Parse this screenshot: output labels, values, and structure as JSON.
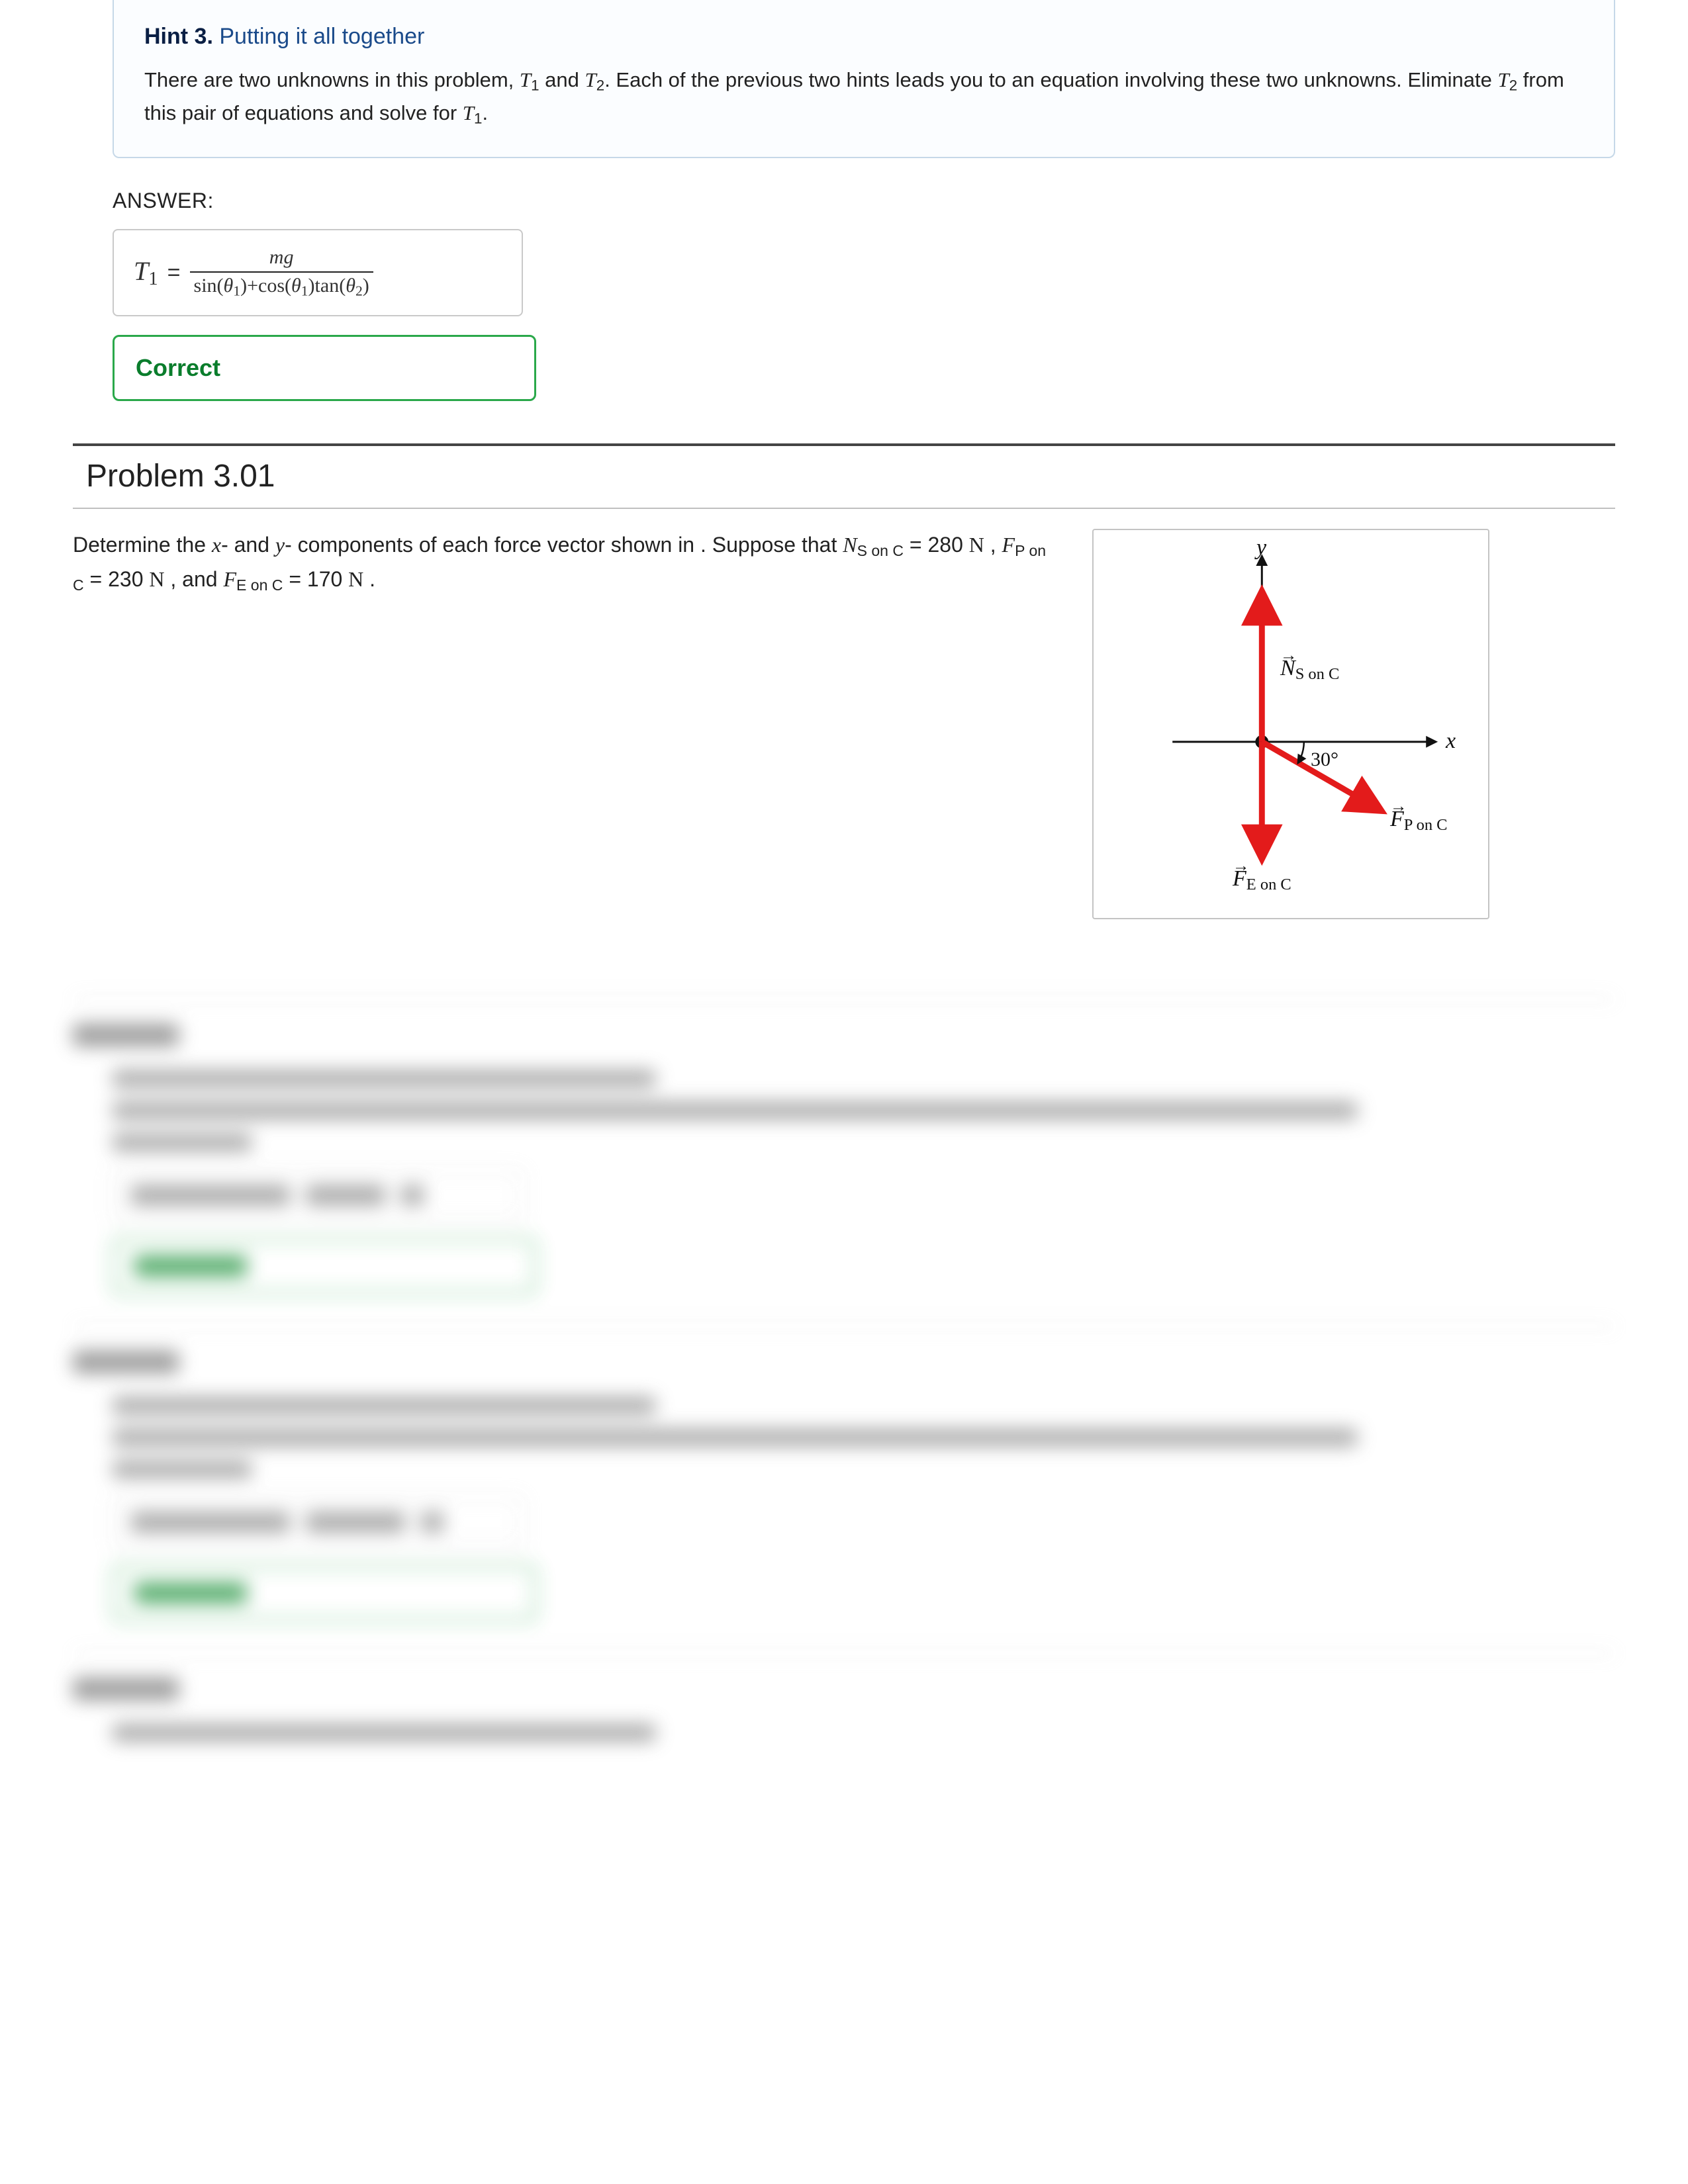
{
  "hint": {
    "number": "Hint 3.",
    "name": "Putting it all together",
    "body_1a": "There are two unknowns in this problem, ",
    "T1": "T",
    "T1sub": "1",
    "body_1b": " and ",
    "T2": "T",
    "T2sub": "2",
    "body_1c": ". Each of the previous two hints leads you to an equation involving these two unknowns. Eliminate ",
    "body_1d": " from this pair of equations and solve for ",
    "body_1e": "."
  },
  "answer_label": "ANSWER:",
  "formula": {
    "lhs": "T",
    "lhs_sub": "1",
    "eq": "=",
    "num_m": "m",
    "num_g": "g",
    "den_sin": "sin",
    "den_th1": "θ",
    "den_1": "1",
    "den_plus": "+",
    "den_cos": "cos",
    "den_tan": "tan",
    "den_th2": "θ",
    "den_2": "2",
    "lp": "(",
    "rp": ")"
  },
  "correct_label": "Correct",
  "problem": {
    "title": "Problem 3.01",
    "p1": "Determine the ",
    "xvar": "x",
    "p2": "- and ",
    "yvar": "y",
    "p3": "- components of each force vector shown in . Suppose that ",
    "NS_sym": "N",
    "NS_sub": "S on C",
    "eq": " = ",
    "NS_val": "280 ",
    "unitN": "N",
    "sep": " , ",
    "FP_sym": "F",
    "FP_sub": "P on C",
    "FP_val": "230 ",
    "and": " , and ",
    "FE_sym": "F",
    "FE_sub": "E on C",
    "FE_val": "170 ",
    "period": " ."
  },
  "figure": {
    "y": "y",
    "x": "x",
    "angle": "30°",
    "N_sym": "N",
    "N_sub": "S on C",
    "FP_sym": "F",
    "FP_sub": "P on C",
    "FE_sym": "F",
    "FE_sub": "E on C"
  },
  "blur": {
    "partA": "Part A",
    "partB": "Part B",
    "partC": "Part C",
    "ansA": "0, 280  N",
    "ansB": "199, -115  N",
    "correct": "Correct"
  }
}
